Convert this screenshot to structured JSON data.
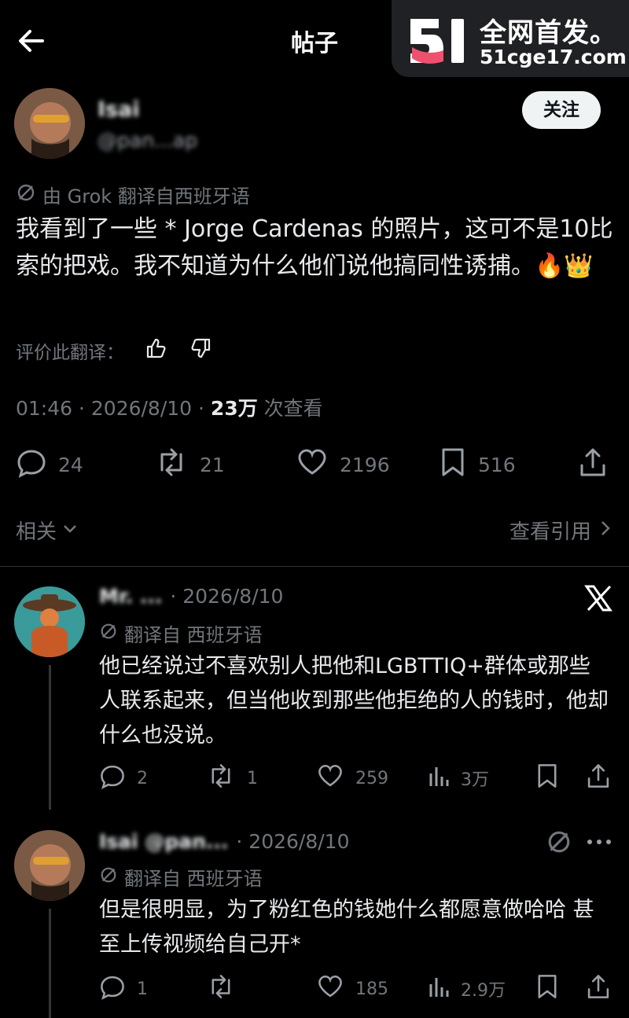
{
  "header": {
    "title": "帖子"
  },
  "watermark": {
    "line1": "全网首发。",
    "line2": "51cge17.com",
    "colors": {
      "pink": "#f0506e",
      "white": "#ffffff"
    }
  },
  "post": {
    "author_name": "Isai",
    "author_handle": "@pan...ap",
    "follow_label": "关注",
    "translated_note": "由 Grok 翻译自西班牙语",
    "body": "我看到了一些 * Jorge Cardenas 的照片，这可不是10比索的把戏。我不知道为什么他们说他搞同性诱捕。🔥👑",
    "rate_label": "评价此翻译：",
    "time": "01:46 · 2026/8/10 · ",
    "views_count": "23万",
    "views_label": " 次查看",
    "stats": {
      "replies": "24",
      "reposts": "21",
      "likes": "2196",
      "bookmarks": "516"
    },
    "related_label": "相关",
    "quotes_label": "查看引用"
  },
  "replies": [
    {
      "name": "Mr. ...",
      "meta": "· 2026/8/10",
      "translated_note": "翻译自 西班牙语",
      "text": "他已经说过不喜欢别人把他和LGBTTIQ+群体或那些人联系起来，但当他收到那些他拒绝的人的钱时，他却什么也没说。",
      "stats": {
        "replies": "2",
        "reposts": "1",
        "likes": "259",
        "views": "3万"
      }
    },
    {
      "name": "Isai @pan...",
      "meta": "· 2026/8/10",
      "translated_note": "翻译自 西班牙语",
      "text": "但是很明显，为了粉红色的钱她什么都愿意做哈哈 甚至上传视频给自己开*",
      "stats": {
        "replies": "1",
        "reposts": "",
        "likes": "185",
        "views": "2.9万"
      }
    }
  ]
}
